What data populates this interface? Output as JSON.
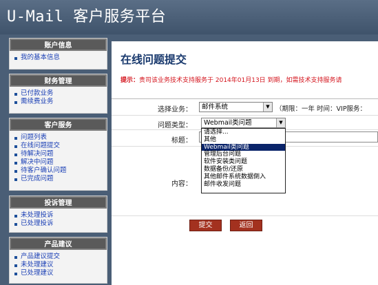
{
  "header": {
    "title": "U-Mail 客户服务平台"
  },
  "sidebar": {
    "panels": [
      {
        "title": "账户信息",
        "items": [
          "我的基本信息"
        ]
      },
      {
        "title": "财务管理",
        "items": [
          "已付款业务",
          "需续费业务"
        ]
      },
      {
        "title": "客户服务",
        "items": [
          "问题列表",
          "在线问题提交",
          "待解决问题",
          "解决中问题",
          "待客户确认问题",
          "已完成问题"
        ]
      },
      {
        "title": "投诉管理",
        "items": [
          "未处理投诉",
          "已处理投诉"
        ]
      },
      {
        "title": "产品建议",
        "items": [
          "产品建议提交",
          "未处理建议",
          "已处理建议"
        ]
      }
    ]
  },
  "main": {
    "title": "在线问题提交",
    "notice_label": "提示：",
    "notice_text": "贵司该业务技术支持服务于 2014年01月13日 到期，如需技术支持服务请",
    "form": {
      "business_label": "选择业务：",
      "business_value": "邮件系统",
      "service_info": "（期限：一年   时间：VIP服务：",
      "type_label": "问题类型：",
      "type_value": "Webmail类问题",
      "type_options": [
        "请选择...",
        "其他",
        "Webmail类问题",
        "管理后台问题",
        "软件安装类问题",
        "数据备份/还原",
        "其他邮件系统数据倒入",
        "邮件收发问题"
      ],
      "type_selected_index": 2,
      "subject_label": "标题：",
      "content_label": "内容：",
      "submit_label": "提交",
      "back_label": "返回"
    }
  }
}
